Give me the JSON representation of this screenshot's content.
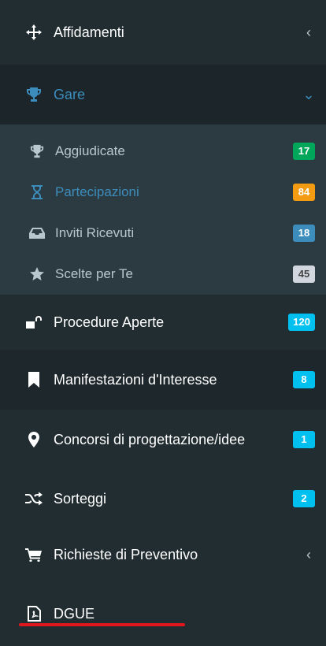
{
  "colors": {
    "sidebar_bg": "#222d32",
    "active_bg": "#1c2529",
    "submenu_bg": "#2c3b41",
    "link_active": "#3c8dbc",
    "text_muted": "#b8c7ce",
    "badge_green": "#00a65a",
    "badge_orange": "#f39c12",
    "badge_blue": "#3c8dbc",
    "badge_light": "#d2d6de",
    "badge_teal": "#00c0ef",
    "underline_red": "#e0181d"
  },
  "menu": {
    "affidamenti": {
      "label": "Affidamenti",
      "icon": "arrows-move-icon",
      "chevron": "‹"
    },
    "gare": {
      "label": "Gare",
      "icon": "trophy-icon",
      "chevron": "⌄",
      "sub": [
        {
          "label": "Aggiudicate",
          "icon": "trophy-icon",
          "badge": "17",
          "badge_color": "green"
        },
        {
          "label": "Partecipazioni",
          "icon": "hourglass-icon",
          "badge": "84",
          "badge_color": "orange"
        },
        {
          "label": "Inviti Ricevuti",
          "icon": "inbox-icon",
          "badge": "18",
          "badge_color": "blue"
        },
        {
          "label": "Scelte per Te",
          "icon": "star-icon",
          "badge": "45",
          "badge_color": "light"
        }
      ]
    },
    "procedure": {
      "label": "Procedure Aperte",
      "icon": "unlock-icon",
      "badge": "120"
    },
    "manifestazioni": {
      "label": "Manifestazioni d'Interesse",
      "icon": "bookmark-icon",
      "badge": "8"
    },
    "concorsi": {
      "label": "Concorsi di progettazione/idee",
      "icon": "map-marker-icon",
      "badge": "1"
    },
    "sorteggi": {
      "label": "Sorteggi",
      "icon": "shuffle-icon",
      "badge": "2"
    },
    "richieste": {
      "label": "Richieste di Preventivo",
      "icon": "cart-icon",
      "chevron": "‹"
    },
    "dgue": {
      "label": "DGUE",
      "icon": "file-pdf-icon"
    }
  }
}
